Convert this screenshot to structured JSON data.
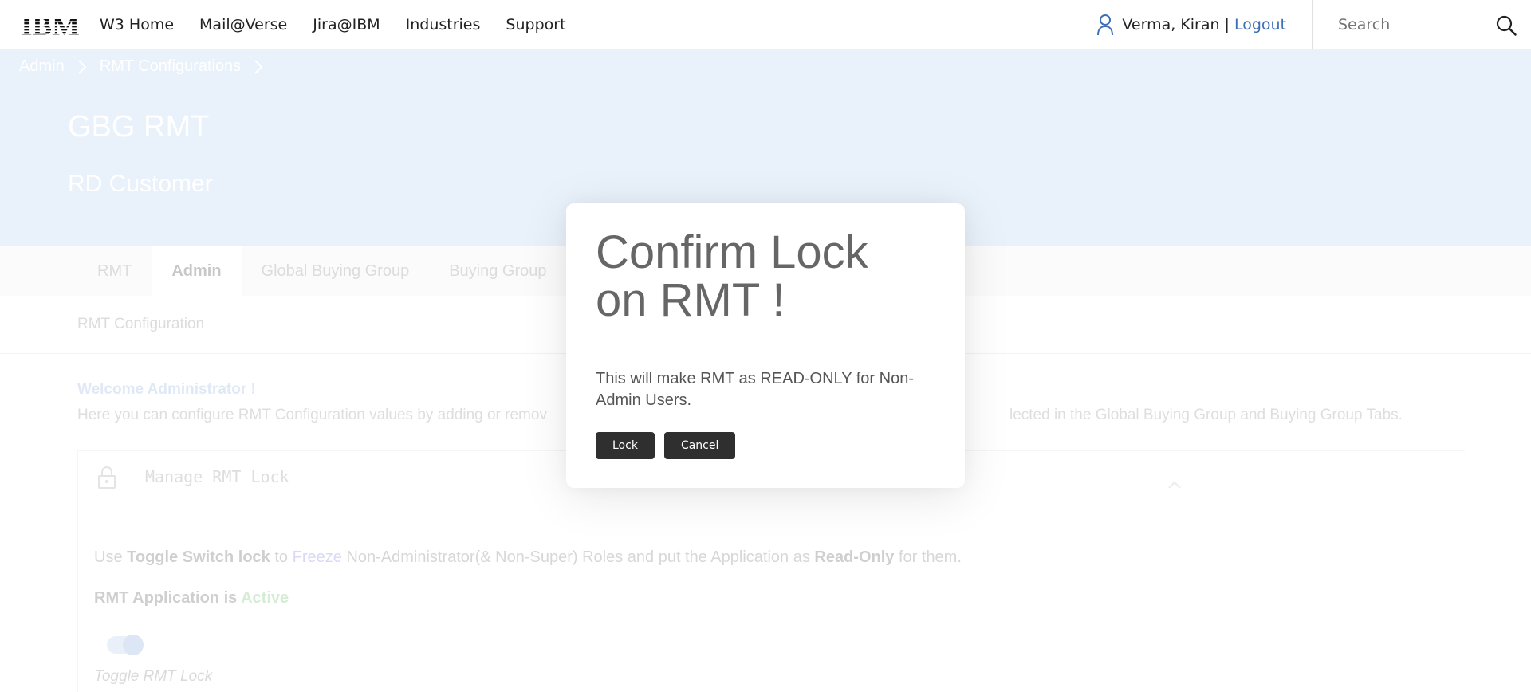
{
  "topnav": {
    "logo_text": "IBM",
    "links": [
      "W3 Home",
      "Mail@Verse",
      "Jira@IBM",
      "Industries",
      "Support"
    ],
    "user_name": "Verma, Kiran",
    "separator": "|",
    "logout_label": "Logout",
    "search_placeholder": "Search"
  },
  "breadcrumb": [
    "Admin",
    "RMT Configurations"
  ],
  "hero": {
    "title": "GBG RMT",
    "subtitle": "RD Customer"
  },
  "tabs": [
    "RMT",
    "Admin",
    "Global Buying Group",
    "Buying Group"
  ],
  "active_tab": "Admin",
  "subtab": "RMT Configuration",
  "welcome": "Welcome Administrator !",
  "intro_left": "Here you can configure RMT Configuration values by adding or remov",
  "intro_right": "lected in the Global Buying Group and Buying Group Tabs.",
  "panel": {
    "title": "Manage RMT Lock",
    "desc": {
      "use": "Use",
      "toggle_switch_lock": "Toggle Switch lock",
      "to": "to",
      "freeze": "Freeze",
      "middle": "Non-Administrator(& Non-Super) Roles and put the Application as",
      "read_only": "Read-Only",
      "end": "for them."
    },
    "status_prefix": "RMT Application is",
    "status_value": "Active",
    "toggle_label": "Toggle RMT Lock"
  },
  "modal": {
    "title": "Confirm Lock on RMT !",
    "body": "This will make RMT as READ-ONLY for Non-Admin Users.",
    "lock_label": "Lock",
    "cancel_label": "Cancel"
  },
  "colors": {
    "hero_bg": "#e9f1fb",
    "link_blue": "#3d6fb6",
    "button_bg": "#2f2f2f"
  }
}
